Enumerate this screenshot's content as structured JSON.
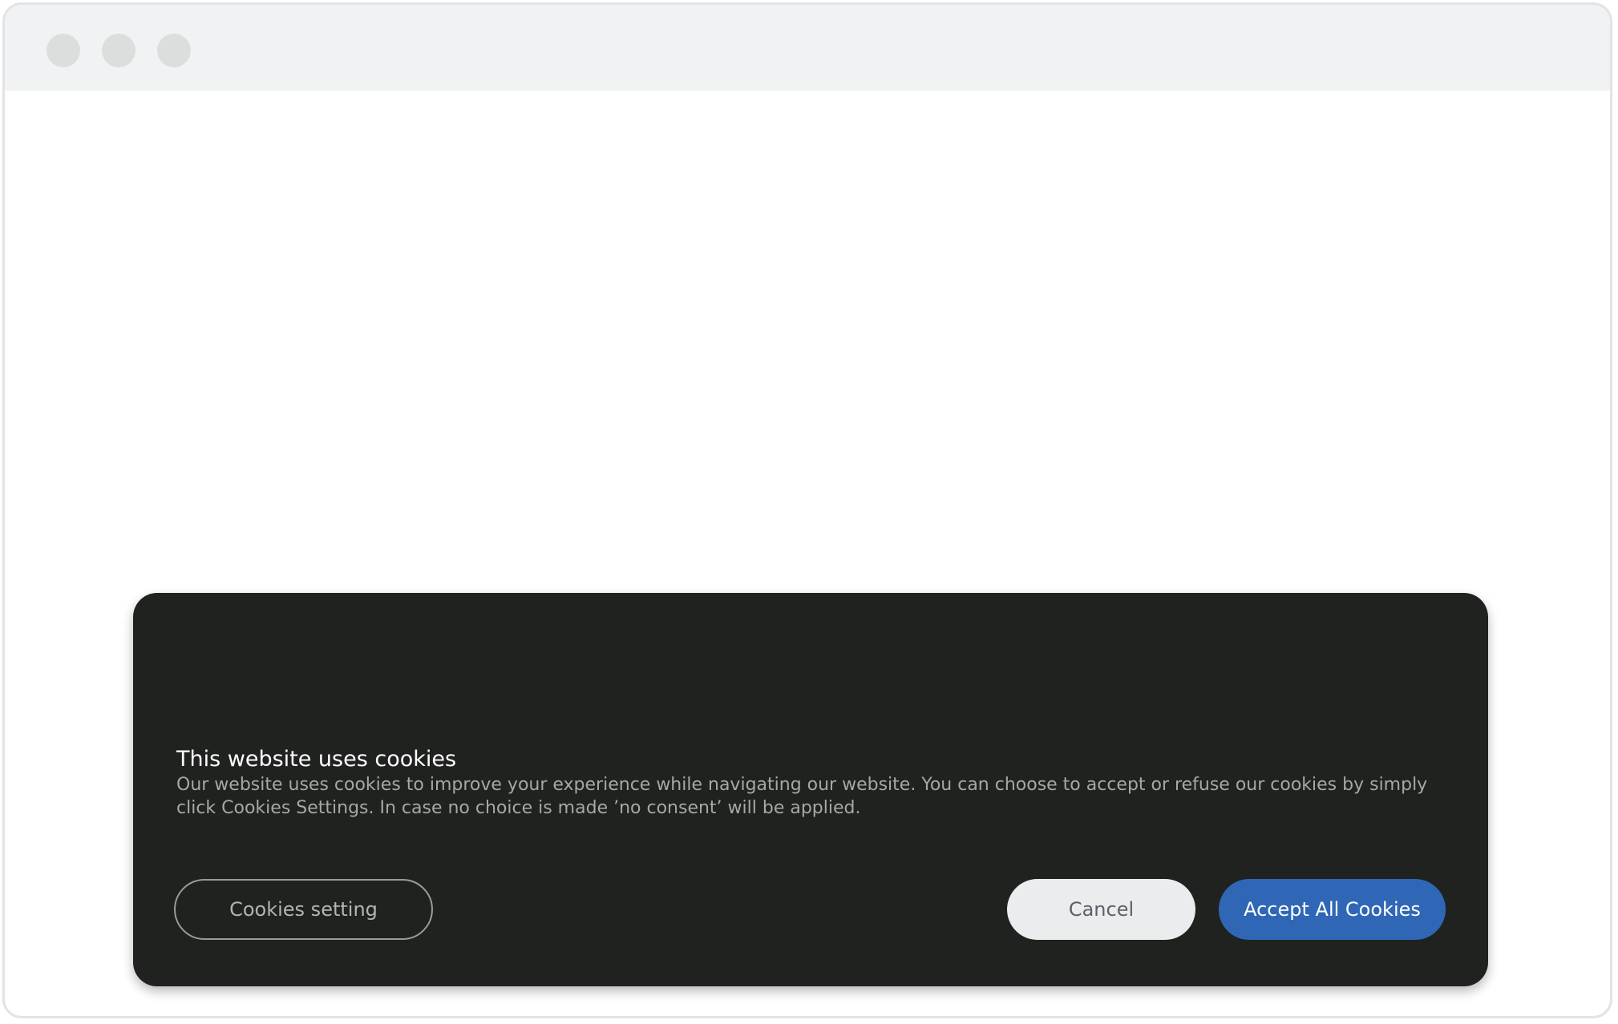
{
  "cookie_banner": {
    "title": "This website uses cookies",
    "description": "Our website uses cookies to improve your experience while navigating our website. You can choose to accept or refuse our cookies by simply click Cookies Settings. In case no choice is made ’no consent’ will be applied.",
    "settings_label": "Cookies setting",
    "cancel_label": "Cancel",
    "accept_label": "Accept All Cookies"
  },
  "colors": {
    "banner_background": "#202220",
    "accept_button": "#2f67b6",
    "cancel_button": "#ebecee",
    "window_titlebar": "#f1f2f3"
  }
}
